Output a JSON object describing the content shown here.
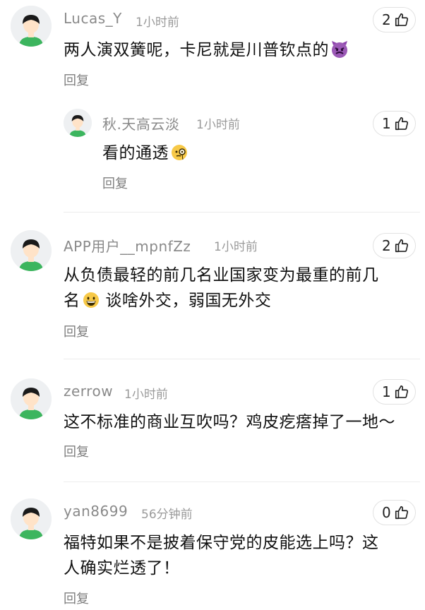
{
  "comments": [
    {
      "username": "Lucas_Y",
      "time": "1小时前",
      "text_lines": [
        "两人演双簧呢，卡尼就是川普钦点的"
      ],
      "emoji": "devil-emoji",
      "likes": "2",
      "reply_label": "回复",
      "replies": [
        {
          "username": "秋.天高云淡",
          "time": "1小时前",
          "text_lines": [
            "看的通透"
          ],
          "emoji": "monocle-emoji",
          "likes": "1",
          "reply_label": "回复"
        }
      ]
    },
    {
      "username": "APP用户__mpnfZz",
      "time": "1小时前",
      "text_lines": [
        "从负债最轻的前几名业国家变为最重的前几",
        "名",
        "谈啥外交，弱国无外交"
      ],
      "emoji": "grin-emoji",
      "likes": "2",
      "reply_label": "回复"
    },
    {
      "username": "zerrow",
      "time": "1小时前",
      "text_lines": [
        "这不标准的商业互吹吗？鸡皮疙瘩掉了一地～"
      ],
      "likes": "1",
      "reply_label": "回复"
    },
    {
      "username": "yan8699",
      "time": "56分钟前",
      "text_lines": [
        "福特如果不是披着保守党的皮能选上吗？这",
        "人确实烂透了！"
      ],
      "likes": "0",
      "reply_label": "回复"
    }
  ],
  "colors": {
    "username": "#8a8a8a",
    "avatar_shirt": "#3cb55e",
    "avatar_hair": "#1a1a1a",
    "avatar_skin": "#ffe3c8"
  }
}
